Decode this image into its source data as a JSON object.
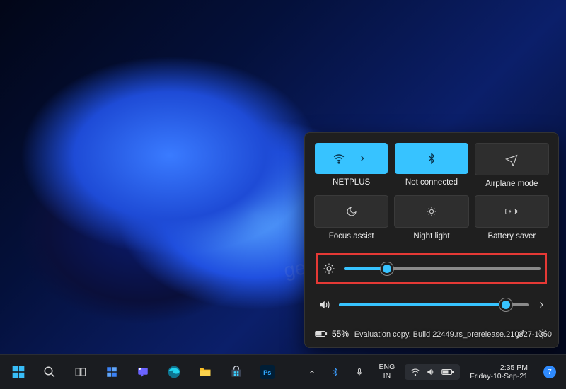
{
  "panel": {
    "tiles": [
      {
        "label": "NETPLUS",
        "state": "on",
        "icon": "wifi",
        "expand": true
      },
      {
        "label": "Not connected",
        "state": "on",
        "icon": "bluetooth",
        "expand": false
      },
      {
        "label": "Airplane mode",
        "state": "off",
        "icon": "airplane",
        "expand": false
      },
      {
        "label": "Focus assist",
        "state": "off",
        "icon": "moon",
        "expand": false
      },
      {
        "label": "Night light",
        "state": "off",
        "icon": "nightlight",
        "expand": false
      },
      {
        "label": "Battery saver",
        "state": "off",
        "icon": "batterysaver",
        "expand": false
      }
    ],
    "brightness_percent": 22,
    "volume_percent": 88,
    "battery_text": "55%"
  },
  "watermark": {
    "line1": "Evaluation copy. Build 22449.rs_prerelease.210827-1350"
  },
  "geeker": "geekermag.com",
  "taskbar": {
    "lang1": "ENG",
    "lang2": "IN",
    "time": "2:35 PM",
    "date": "Friday-10-Sep-21",
    "notif_count": "7"
  }
}
